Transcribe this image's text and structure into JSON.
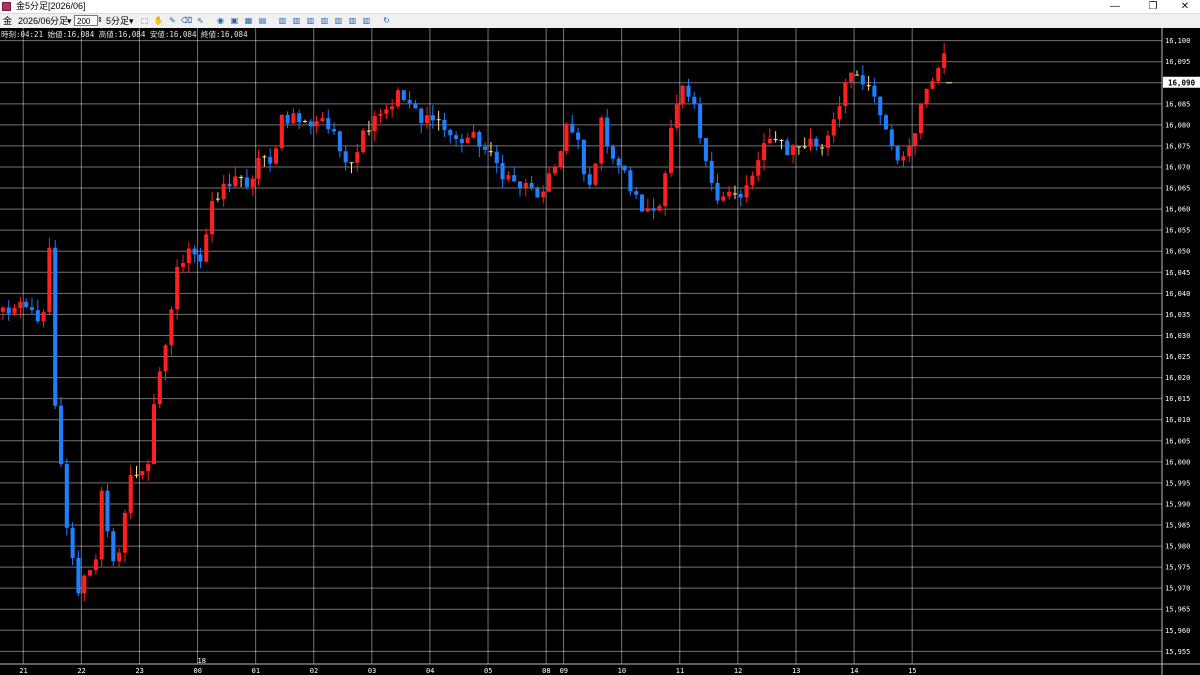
{
  "window": {
    "title": "金5分足[2026/06]",
    "minimize_glyph": "—",
    "maximize_glyph": "❐",
    "close_glyph": "✕"
  },
  "toolbar": {
    "instrument": "金",
    "contract": "2026/06",
    "unit_label": "分足",
    "bar_count": "200",
    "interval": "5分足",
    "icons": [
      "select-icon",
      "hand-icon",
      "pencil-icon",
      "eraser-icon",
      "cursor-icon",
      "circle-icon",
      "window-icon",
      "grid-icon",
      "table-icon",
      "bar-chart-icon",
      "bar-chart-2-icon",
      "bar-chart-3-icon",
      "bar-chart-4-icon",
      "bar-chart-5-icon",
      "bar-chart-6-icon",
      "bar-chart-7-icon",
      "refresh-icon"
    ]
  },
  "info": {
    "text": "時刻:04:21 始値:16,084 高値:16,084 安値:16,084 終値:16,084"
  },
  "colors": {
    "background": "#000000",
    "grid": "#ffffff",
    "up": "#ff1f1f",
    "down": "#1e7fff",
    "doji": "#ffe39a",
    "current_price_bg": "#ffffff"
  },
  "chart_data": {
    "type": "candlestick",
    "y_axis": {
      "min": 15952,
      "max": 16103,
      "ticks": [
        16100,
        16095,
        16090,
        16085,
        16080,
        16075,
        16070,
        16065,
        16060,
        16055,
        16050,
        16045,
        16040,
        16035,
        16030,
        16025,
        16020,
        16015,
        16010,
        16005,
        16000,
        15995,
        15990,
        15985,
        15980,
        15975,
        15970,
        15965,
        15960,
        15955
      ],
      "tick_labels": [
        "16,100",
        "16,095",
        "16,090",
        "16,085",
        "16,080",
        "16,075",
        "16,070",
        "16,065",
        "16,060",
        "16,055",
        "16,050",
        "16,045",
        "16,040",
        "16,035",
        "16,030",
        "16,025",
        "16,020",
        "16,015",
        "16,010",
        "16,005",
        "16,000",
        "15,995",
        "15,990",
        "15,985",
        "15,980",
        "15,975",
        "15,970",
        "15,965",
        "15,960",
        "15,955"
      ]
    },
    "x_axis": {
      "bar_count": 200,
      "labels": [
        {
          "bar": 4,
          "text": "21"
        },
        {
          "bar": 14,
          "text": "22"
        },
        {
          "bar": 24,
          "text": "23"
        },
        {
          "bar": 34,
          "text": "00"
        },
        {
          "bar": 44,
          "text": "01"
        },
        {
          "bar": 54,
          "text": "02"
        },
        {
          "bar": 64,
          "text": "03"
        },
        {
          "bar": 74,
          "text": "04"
        },
        {
          "bar": 84,
          "text": "05"
        },
        {
          "bar": 94,
          "text": "08"
        },
        {
          "bar": 97,
          "text": "09"
        },
        {
          "bar": 107,
          "text": "10"
        },
        {
          "bar": 117,
          "text": "11"
        },
        {
          "bar": 127,
          "text": "12"
        },
        {
          "bar": 137,
          "text": "13"
        },
        {
          "bar": 147,
          "text": "14"
        },
        {
          "bar": 157,
          "text": "15"
        }
      ],
      "extra_labels": [
        {
          "bar": 34,
          "text": "18"
        }
      ]
    },
    "current_price": 16090,
    "current_price_label": "16,090",
    "waypoints": [
      [
        0,
        16036
      ],
      [
        4,
        16036
      ],
      [
        7,
        16034
      ],
      [
        8,
        16050
      ],
      [
        9,
        16012
      ],
      [
        11,
        15985
      ],
      [
        12,
        15976
      ],
      [
        13,
        15970
      ],
      [
        16,
        15978
      ],
      [
        17,
        15992
      ],
      [
        18,
        15982
      ],
      [
        19,
        15975
      ],
      [
        20,
        15980
      ],
      [
        22,
        15996
      ],
      [
        25,
        16000
      ],
      [
        26,
        16012
      ],
      [
        28,
        16028
      ],
      [
        30,
        16045
      ],
      [
        32,
        16052
      ],
      [
        34,
        16048
      ],
      [
        36,
        16060
      ],
      [
        38,
        16065
      ],
      [
        40,
        16068
      ],
      [
        42,
        16064
      ],
      [
        44,
        16072
      ],
      [
        46,
        16070
      ],
      [
        48,
        16082
      ],
      [
        50,
        16082
      ],
      [
        52,
        16080
      ],
      [
        55,
        16082
      ],
      [
        58,
        16074
      ],
      [
        60,
        16072
      ],
      [
        62,
        16078
      ],
      [
        64,
        16083
      ],
      [
        66,
        16084
      ],
      [
        68,
        16087
      ],
      [
        70,
        16085
      ],
      [
        72,
        16080
      ],
      [
        74,
        16083
      ],
      [
        76,
        16079
      ],
      [
        78,
        16076
      ],
      [
        80,
        16077
      ],
      [
        82,
        16076
      ],
      [
        84,
        16072
      ],
      [
        88,
        16066
      ],
      [
        90,
        16065
      ],
      [
        93,
        16063
      ],
      [
        95,
        16070
      ],
      [
        97,
        16080
      ],
      [
        99,
        16075
      ],
      [
        100,
        16068
      ],
      [
        101,
        16065
      ],
      [
        103,
        16080
      ],
      [
        105,
        16073
      ],
      [
        107,
        16068
      ],
      [
        109,
        16062
      ],
      [
        111,
        16059
      ],
      [
        113,
        16061
      ],
      [
        115,
        16080
      ],
      [
        117,
        16088
      ],
      [
        119,
        16083
      ],
      [
        121,
        16070
      ],
      [
        123,
        16064
      ],
      [
        125,
        16064
      ],
      [
        127,
        16062
      ],
      [
        129,
        16068
      ],
      [
        131,
        16074
      ],
      [
        133,
        16078
      ],
      [
        135,
        16074
      ],
      [
        137,
        16075
      ],
      [
        139,
        16076
      ],
      [
        141,
        16075
      ],
      [
        143,
        16082
      ],
      [
        145,
        16090
      ],
      [
        147,
        16091
      ],
      [
        149,
        16088
      ],
      [
        151,
        16083
      ],
      [
        153,
        16075
      ],
      [
        155,
        16071
      ],
      [
        157,
        16080
      ],
      [
        159,
        16089
      ],
      [
        161,
        16095
      ],
      [
        162,
        16097
      ]
    ]
  }
}
